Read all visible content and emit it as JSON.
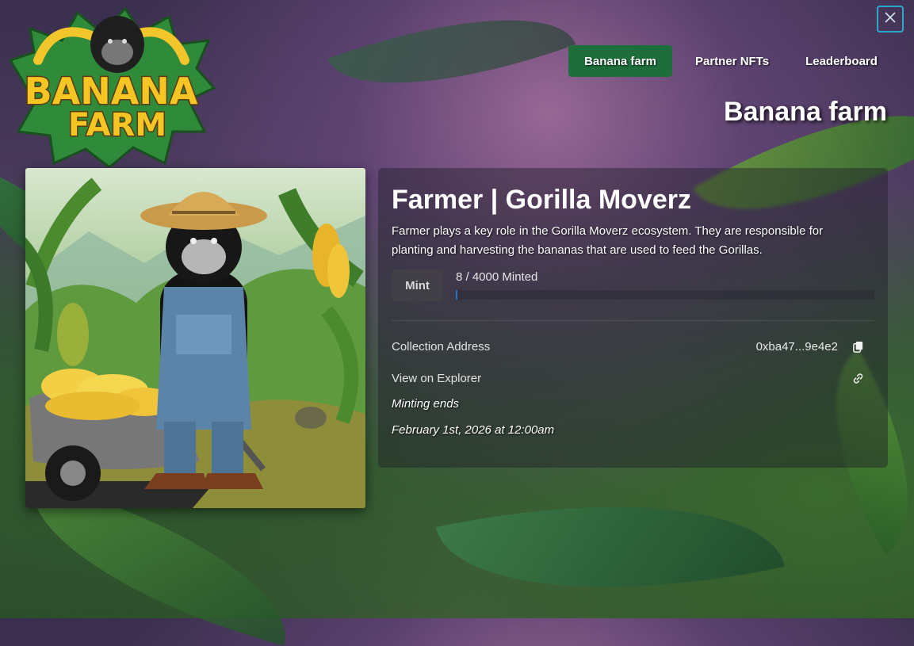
{
  "logo": {
    "line1": "BANANA",
    "line2": "FARM"
  },
  "nav": {
    "items": [
      {
        "label": "Banana farm",
        "active": true
      },
      {
        "label": "Partner NFTs",
        "active": false
      },
      {
        "label": "Leaderboard",
        "active": false
      }
    ]
  },
  "page_heading": "Banana farm",
  "nft": {
    "title": "Farmer | Gorilla Moverz",
    "description": "Farmer plays a key role in the Gorilla Moverz ecosystem. They are responsible for planting and harvesting the bananas that are used to feed the Gorillas.",
    "mint_label": "Mint",
    "minted_text": "8 / 4000 Minted",
    "minted_fraction": 0.002,
    "collection_address_label": "Collection Address",
    "collection_address": "0xba47...9e4e2",
    "explorer_label": "View on Explorer",
    "minting_ends_label": "Minting ends",
    "minting_ends_date": "February 1st, 2026 at 12:00am"
  },
  "icons": {
    "close": "close-icon",
    "copy": "copy-icon",
    "link": "link-icon"
  },
  "colors": {
    "nav_active": "#1e6e3c",
    "close_border": "#2aa8c9",
    "progress": "#2a72c0"
  }
}
